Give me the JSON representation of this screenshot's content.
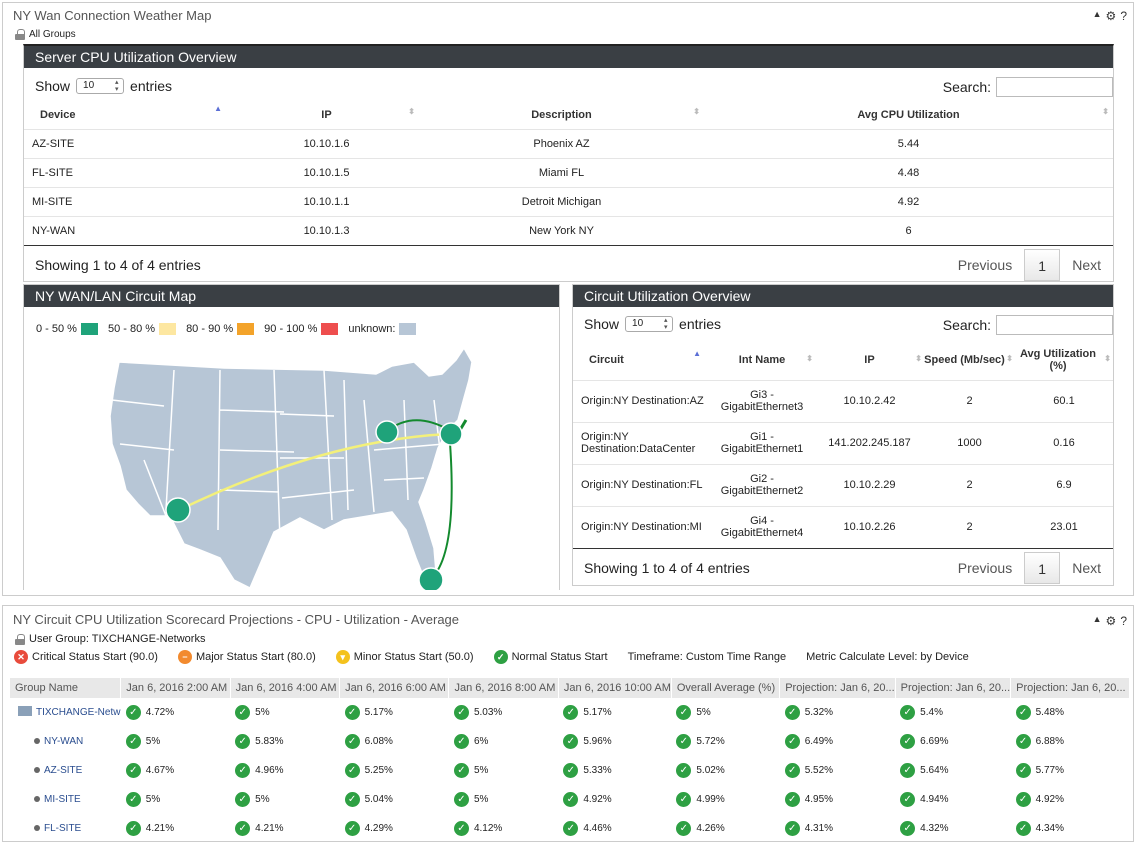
{
  "top_panel": {
    "title": "NY Wan Connection Weather Map",
    "group": "All Groups"
  },
  "cpu_widget": {
    "title": "Server CPU Utilization Overview",
    "show": "Show",
    "page_size": "10",
    "entries": "entries",
    "search": "Search:",
    "columns": [
      "Device",
      "IP",
      "Description",
      "Avg CPU Utilization"
    ],
    "rows": [
      [
        "AZ-SITE",
        "10.10.1.6",
        "Phoenix AZ",
        "5.44"
      ],
      [
        "FL-SITE",
        "10.10.1.5",
        "Miami FL",
        "4.48"
      ],
      [
        "MI-SITE",
        "10.10.1.1",
        "Detroit Michigan",
        "4.92"
      ],
      [
        "NY-WAN",
        "10.10.1.3",
        "New York NY",
        "6"
      ]
    ],
    "info": "Showing 1 to 4 of 4 entries",
    "prev": "Previous",
    "page": "1",
    "next": "Next"
  },
  "map_widget": {
    "title": "NY WAN/LAN Circuit Map",
    "legend": [
      {
        "label": "0 - 50 %",
        "color": "#1fa37a"
      },
      {
        "label": "50 - 80 %",
        "color": "#fde7a1"
      },
      {
        "label": "80 - 90 %",
        "color": "#f3a32a"
      },
      {
        "label": "90 - 100 %",
        "color": "#ee4e4e"
      },
      {
        "label": "unknown:",
        "color": "#b7c6d6"
      }
    ]
  },
  "circuit_widget": {
    "title": "Circuit Utilization Overview",
    "show": "Show",
    "page_size": "10",
    "entries": "entries",
    "search": "Search:",
    "columns": [
      "Circuit",
      "Int Name",
      "IP",
      "Speed (Mb/sec)",
      "Avg Utilization (%)"
    ],
    "rows": [
      [
        "Origin:NY Destination:AZ",
        "Gi3 - GigabitEthernet3",
        "10.10.2.42",
        "2",
        "60.1"
      ],
      [
        "Origin:NY Destination:DataCenter",
        "Gi1 - GigabitEthernet1",
        "141.202.245.187",
        "1000",
        "0.16"
      ],
      [
        "Origin:NY Destination:FL",
        "Gi2 - GigabitEthernet2",
        "10.10.2.29",
        "2",
        "6.9"
      ],
      [
        "Origin:NY Destination:MI",
        "Gi4 - GigabitEthernet4",
        "10.10.2.26",
        "2",
        "23.01"
      ]
    ],
    "info": "Showing 1 to 4 of 4 entries",
    "prev": "Previous",
    "page": "1",
    "next": "Next"
  },
  "scorecard": {
    "title": "NY Circuit CPU Utilization Scorecard Projections - CPU - Utilization - Average",
    "user_group": "User Group: TIXCHANGE-Networks",
    "status": {
      "critical": "Critical Status Start (90.0)",
      "major": "Major Status Start (80.0)",
      "minor": "Minor Status Start (50.0)",
      "normal": "Normal Status Start",
      "timeframe": "Timeframe: Custom Time Range",
      "metric": "Metric Calculate Level: by Device"
    },
    "columns": [
      "Group Name",
      "Jan 6, 2016 2:00 AM",
      "Jan 6, 2016 4:00 AM",
      "Jan 6, 2016 6:00 AM",
      "Jan 6, 2016 8:00 AM",
      "Jan 6, 2016 10:00 AM",
      "Overall Average (%)",
      "Projection: Jan 6, 20...",
      "Projection: Jan 6, 20...",
      "Projection: Jan 6, 20..."
    ],
    "rows": [
      {
        "name": "TIXCHANGE-Netw",
        "values": [
          "4.72%",
          "5%",
          "5.17%",
          "5.03%",
          "5.17%",
          "5%",
          "5.32%",
          "5.4%",
          "5.48%"
        ]
      },
      {
        "name": "NY-WAN",
        "values": [
          "5%",
          "5.83%",
          "6.08%",
          "6%",
          "5.96%",
          "5.72%",
          "6.49%",
          "6.69%",
          "6.88%"
        ]
      },
      {
        "name": "AZ-SITE",
        "values": [
          "4.67%",
          "4.96%",
          "5.25%",
          "5%",
          "5.33%",
          "5.02%",
          "5.52%",
          "5.64%",
          "5.77%"
        ]
      },
      {
        "name": "MI-SITE",
        "values": [
          "5%",
          "5%",
          "5.04%",
          "5%",
          "4.92%",
          "4.99%",
          "4.95%",
          "4.94%",
          "4.92%"
        ]
      },
      {
        "name": "FL-SITE",
        "values": [
          "4.21%",
          "4.21%",
          "4.29%",
          "4.12%",
          "4.46%",
          "4.26%",
          "4.31%",
          "4.32%",
          "4.34%"
        ]
      }
    ]
  }
}
